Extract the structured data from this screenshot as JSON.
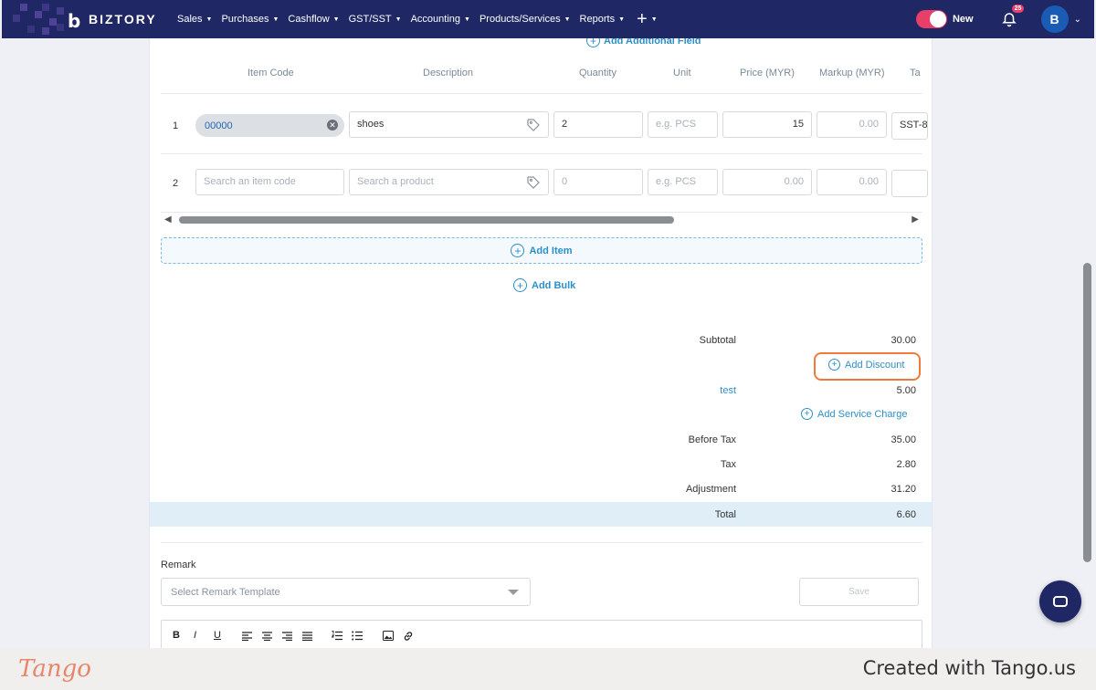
{
  "app": {
    "name": "BIZTORY"
  },
  "nav": {
    "menu": [
      {
        "label": "Sales"
      },
      {
        "label": "Purchases"
      },
      {
        "label": "Cashflow"
      },
      {
        "label": "GST/SST"
      },
      {
        "label": "Accounting"
      },
      {
        "label": "Products/Services"
      },
      {
        "label": "Reports"
      }
    ],
    "plus_icon": "plus-icon",
    "toggle_label": "New",
    "notifications_count": "25",
    "avatar_initial": "B"
  },
  "form": {
    "add_additional_field": "Add Additional Field",
    "columns": [
      "Item Code",
      "Description",
      "Quantity",
      "Unit",
      "Price (MYR)",
      "Markup (MYR)",
      "Ta"
    ],
    "rows": [
      {
        "num": "1",
        "item_code": "00000",
        "description": "shoes",
        "quantity": "2",
        "unit_placeholder": "e.g. PCS",
        "price": "15",
        "markup": "0.00",
        "tax": "SST-8"
      },
      {
        "num": "2",
        "item_code_placeholder": "Search an item code",
        "description_placeholder": "Search a product",
        "quantity_placeholder": "0",
        "unit_placeholder": "e.g. PCS",
        "price_placeholder": "0.00",
        "markup_placeholder": "0.00"
      }
    ],
    "add_item": "Add Item",
    "add_bulk": "Add Bulk"
  },
  "summary": {
    "subtotal_label": "Subtotal",
    "subtotal": "30.00",
    "add_discount": "Add Discount",
    "charge_name": "test",
    "charge_value": "5.00",
    "add_service_charge": "Add Service Charge",
    "before_tax_label": "Before Tax",
    "before_tax": "35.00",
    "tax_label": "Tax",
    "tax": "2.80",
    "adjustment_label": "Adjustment",
    "adjustment": "31.20",
    "total_label": "Total",
    "total": "6.60"
  },
  "remark": {
    "label": "Remark",
    "select_placeholder": "Select Remark Template",
    "save_label": "Save",
    "toolbar": [
      "B",
      "I",
      "U"
    ]
  },
  "footer": {
    "logo": "Tango",
    "created": "Created with Tango.us"
  },
  "colors": {
    "nav_bg": "#1f2764",
    "accent": "#2c8fc9",
    "highlight": "#f07a3c",
    "toggle": "#e83e6a"
  }
}
